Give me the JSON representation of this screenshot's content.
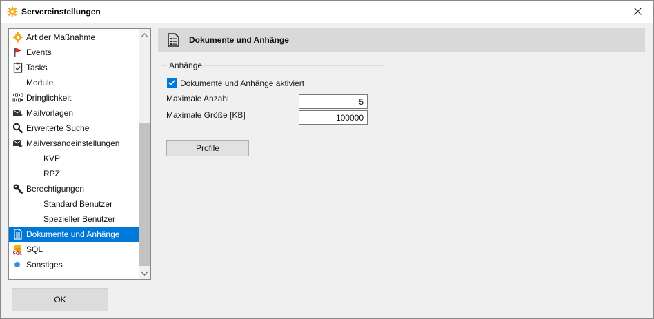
{
  "window": {
    "title": "Servereinstellungen",
    "title_icon": "gear-icon",
    "close_icon": "close-icon"
  },
  "tree": {
    "items": [
      {
        "label": "Art der Maßnahme",
        "icon": "orange-gear-icon",
        "level": 0,
        "selected": false
      },
      {
        "label": "Events",
        "icon": "red-flag-icon",
        "level": 0,
        "selected": false
      },
      {
        "label": "Tasks",
        "icon": "checklist-icon",
        "level": 0,
        "selected": false
      },
      {
        "label": "Module",
        "icon": "",
        "level": 0,
        "selected": false
      },
      {
        "label": "Dringlichkeit",
        "icon": "binary-icon",
        "level": 0,
        "selected": false
      },
      {
        "label": "Mailvorlagen",
        "icon": "mail-icon",
        "level": 0,
        "selected": false
      },
      {
        "label": "Erweiterte Suche",
        "icon": "magnifier-icon",
        "level": 0,
        "selected": false
      },
      {
        "label": "Mailversandeinstellungen",
        "icon": "mail-send-icon",
        "level": 0,
        "selected": false
      },
      {
        "label": "KVP",
        "icon": "",
        "level": 1,
        "selected": false
      },
      {
        "label": "RPZ",
        "icon": "",
        "level": 1,
        "selected": false
      },
      {
        "label": "Berechtigungen",
        "icon": "key-icon",
        "level": 0,
        "selected": false
      },
      {
        "label": "Standard Benutzer",
        "icon": "",
        "level": 1,
        "selected": false
      },
      {
        "label": "Spezieller Benutzer",
        "icon": "",
        "level": 1,
        "selected": false
      },
      {
        "label": "Dokumente und Anhänge",
        "icon": "document-icon",
        "level": 0,
        "selected": true
      },
      {
        "label": "SQL",
        "icon": "sql-database-icon",
        "level": 0,
        "selected": false
      },
      {
        "label": "Sonstiges",
        "icon": "blue-dot-icon",
        "level": 0,
        "selected": false
      }
    ]
  },
  "ok_button": {
    "label": "OK"
  },
  "panel": {
    "title": "Dokumente und Anhänge",
    "icon": "document-list-icon",
    "group": {
      "legend": "Anhänge",
      "checkbox_label": "Dokumente und Anhänge aktiviert",
      "checkbox_checked": true,
      "max_count_label": "Maximale Anzahl",
      "max_count_value": "5",
      "max_size_label": "Maximale Größe [KB]",
      "max_size_value": "100000"
    },
    "profile_button": "Profile"
  },
  "colors": {
    "selection": "#0078d7",
    "header_bg": "#d9d9d9",
    "window_bg": "#f0f0f0"
  }
}
